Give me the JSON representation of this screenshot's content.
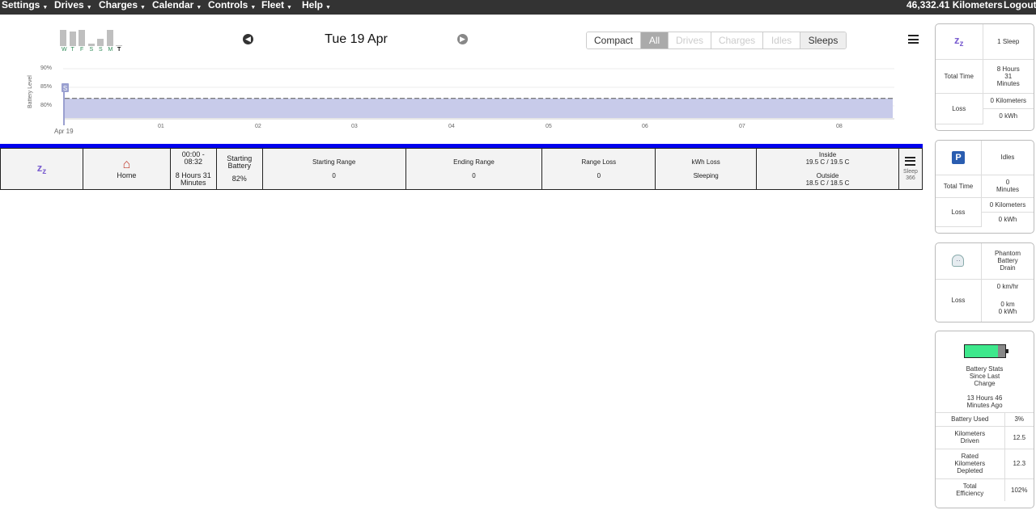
{
  "nav": {
    "menus": [
      {
        "label": "Settings",
        "left": 2
      },
      {
        "label": "Drives",
        "left": 67
      },
      {
        "label": "Charges",
        "left": 122
      },
      {
        "label": "Calendar",
        "left": 188
      },
      {
        "label": "Controls",
        "left": 257
      },
      {
        "label": "Fleet",
        "left": 323
      },
      {
        "label": "Help",
        "left": 373
      }
    ],
    "odometer": "46,332.41 Kilometers",
    "logout": "Logout"
  },
  "week": {
    "days": [
      "W",
      "T",
      "F",
      "S",
      "S",
      "M",
      "T"
    ],
    "levels": [
      1.0,
      0.9,
      1.0,
      0.15,
      0.45,
      1.0,
      0.0
    ]
  },
  "header": {
    "date": "Tue 19 Apr",
    "filters": [
      "Compact",
      "All",
      "Drives",
      "Charges",
      "Idles",
      "Sleeps"
    ]
  },
  "chart_data": {
    "type": "area",
    "ylabel": "Battery Level",
    "y_ticks": [
      "90%",
      "85%",
      "80%"
    ],
    "x_ticks": [
      "Apr 19",
      "01",
      "02",
      "03",
      "04",
      "05",
      "06",
      "07",
      "08"
    ],
    "battery_level_pct": 82,
    "marker": "S",
    "color": "#c8cbea"
  },
  "row": {
    "location": "Home",
    "time_range": "00:00 - 08:32",
    "duration": "8 Hours 31 Minutes",
    "starting_battery_label": "Starting Battery",
    "starting_battery": "82%",
    "starting_range_label": "Starting Range",
    "starting_range": "0",
    "ending_range_label": "Ending Range",
    "ending_range": "0",
    "range_loss_label": "Range Loss",
    "range_loss": "0",
    "kwh_loss_label": "kWh Loss",
    "kwh_loss": "Sleeping",
    "inside_label": "Inside",
    "inside": "19.5 C / 19.5 C",
    "outside_label": "Outside",
    "outside": "18.5 C / 18.5 C",
    "sleep_label": "Sleep",
    "sleep_id": "366"
  },
  "sleep_card": {
    "title": "1 Sleep",
    "total_time_label": "Total Time",
    "total_time": "8 Hours 31 Minutes",
    "loss_label": "Loss",
    "loss_km": "0 Kilometers",
    "loss_kwh": "0 kWh"
  },
  "idle_card": {
    "badge": "P",
    "title": "Idles",
    "total_time_label": "Total Time",
    "total_time": "0 Minutes",
    "loss_label": "Loss",
    "loss_km": "0 Kilometers",
    "loss_kwh": "0 kWh"
  },
  "phantom_card": {
    "title": "Phantom Battery Drain",
    "loss_label": "Loss",
    "rate": "0 km/hr",
    "loss_km": "0 km",
    "loss_kwh": "0 kWh"
  },
  "battery_card": {
    "title": "Battery Stats Since Last Charge",
    "since": "13 Hours 46 Minutes Ago",
    "rows": [
      {
        "label": "Battery Used",
        "value": "3%"
      },
      {
        "label": "Kilometers Driven",
        "value": "12.5"
      },
      {
        "label": "Rated Kilometers Depleted",
        "value": "12.3"
      },
      {
        "label": "Total Efficiency",
        "value": "102%"
      }
    ],
    "level_pct": 82,
    "color": "#3ee88c"
  }
}
